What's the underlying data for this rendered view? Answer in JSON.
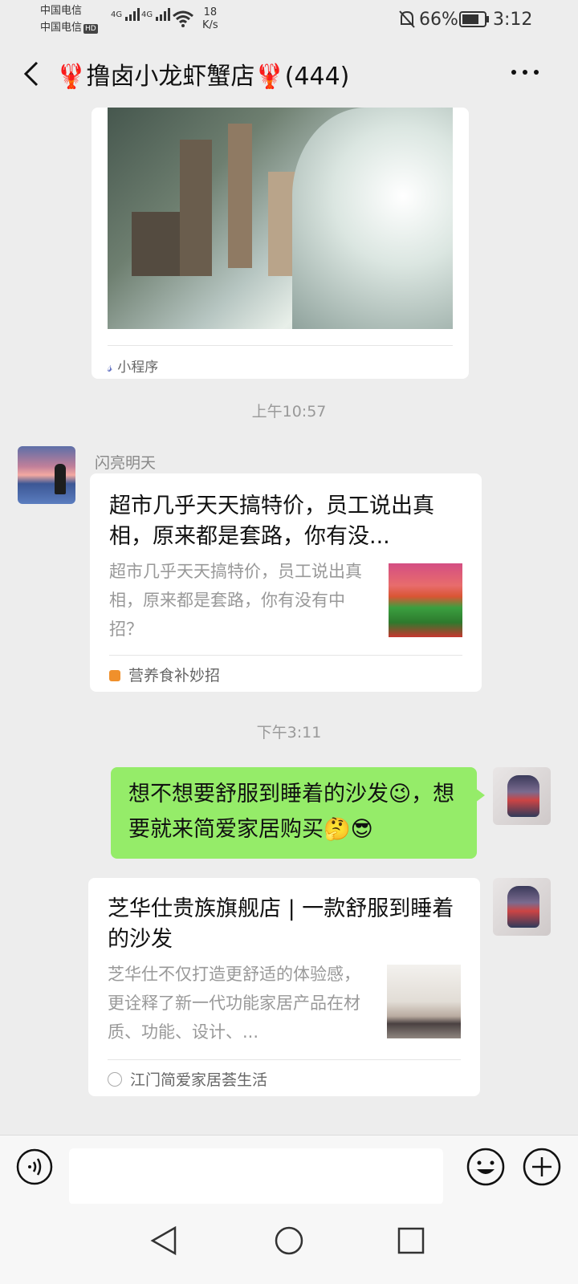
{
  "status_bar": {
    "carrier1": "中国电信",
    "carrier2": "中国电信",
    "hd": "HD",
    "net1": "4G",
    "net2": "4G",
    "speed_value": "18",
    "speed_unit": "K/s",
    "battery": "66%",
    "time": "3:12"
  },
  "header": {
    "title": "🦞撸卤小龙虾蟹店🦞(444)"
  },
  "messages": {
    "mini_program": {
      "label": "小程序"
    },
    "time1": "上午10:57",
    "article1": {
      "sender": "闪亮明天",
      "title": "超市几乎天天搞特价，员工说出真相，原来都是套路，你有没...",
      "desc": "超市几乎天天搞特价，员工说出真相，原来都是套路，你有没有中招？",
      "source": "营养食补妙招"
    },
    "time2": "下午3:11",
    "text_message": "想不想要舒服到睡着的沙发😉，想要就来简爱家居购买🤔😎",
    "article2": {
      "title": "芝华仕贵族旗舰店 | 一款舒服到睡着的沙发",
      "desc": "芝华仕不仅打造更舒适的体验感，更诠释了新一代功能家居产品在材质、功能、设计、...",
      "source": "江门简爱家居荟生活"
    }
  },
  "colors": {
    "background": "#ededed",
    "bubble_self": "#95ec69",
    "card": "#ffffff"
  }
}
